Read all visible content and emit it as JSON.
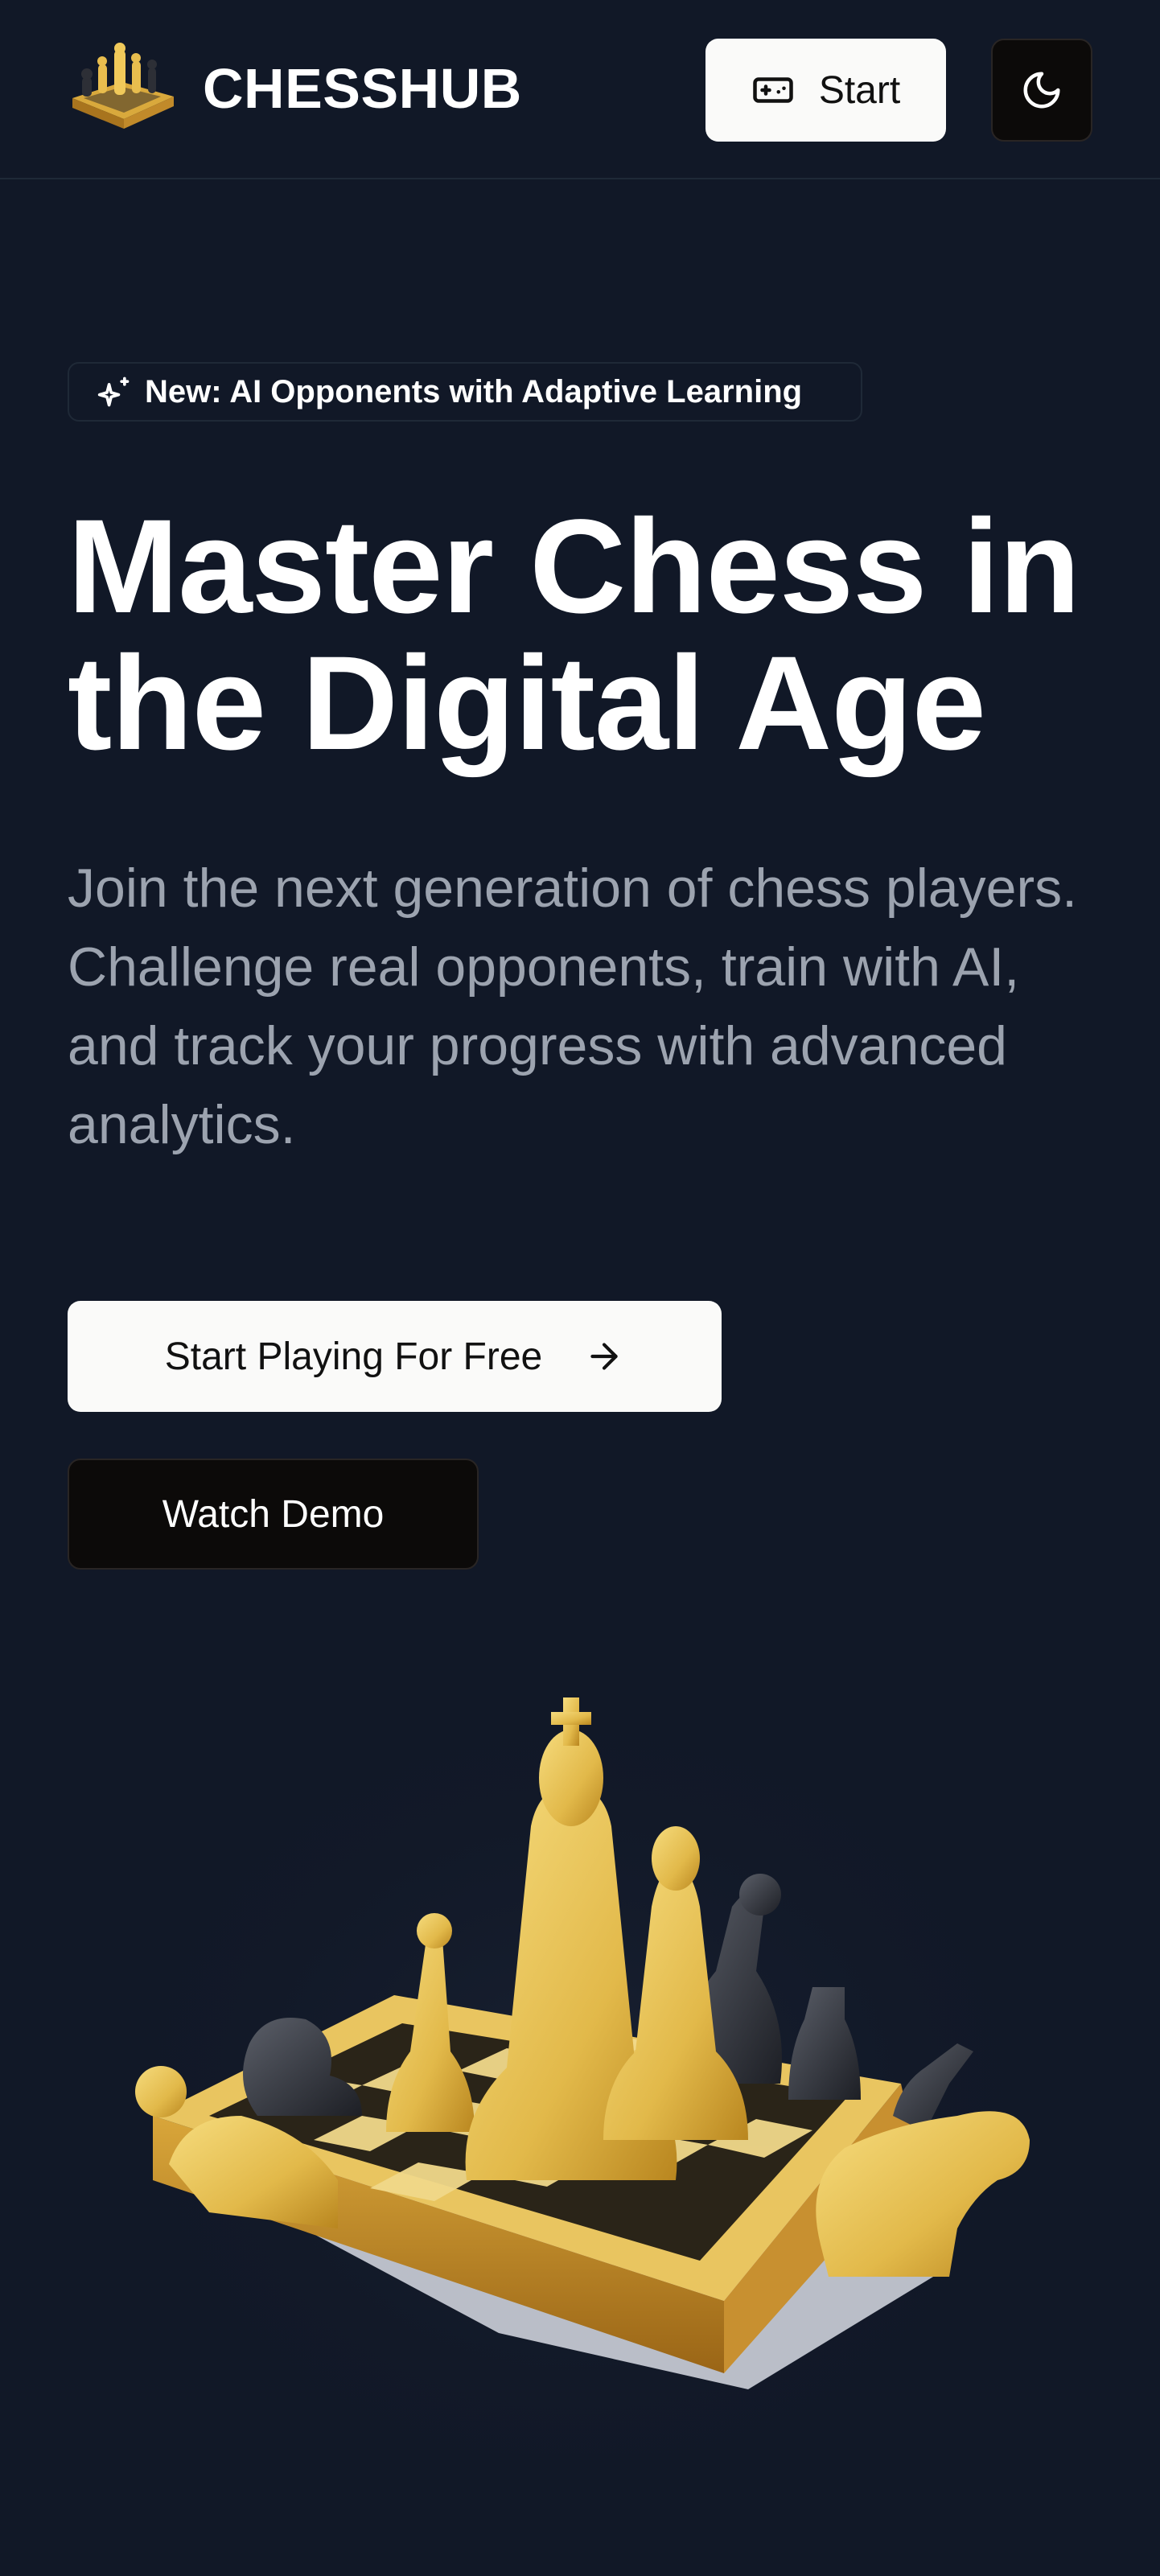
{
  "header": {
    "brand": "CHESSHUB",
    "start_label": "Start",
    "start_icon": "gamepad-icon",
    "theme_icon": "moon-icon"
  },
  "hero": {
    "badge_icon": "sparkles-icon",
    "badge_text": "New: AI Opponents with Adaptive Learning",
    "title": "Master Chess in the Digital Age",
    "subtitle": "Join the next generation of chess players. Challenge real opponents, train with AI, and track your progress with advanced analytics.",
    "primary_cta": "Start Playing For Free",
    "primary_cta_icon": "arrow-right-icon",
    "secondary_cta": "Watch Demo"
  },
  "colors": {
    "background": "#111827",
    "button_light": "#fafaf9",
    "button_dark": "#0c0a09",
    "muted_text": "#9ca3af",
    "gold": "#e2b94a"
  }
}
